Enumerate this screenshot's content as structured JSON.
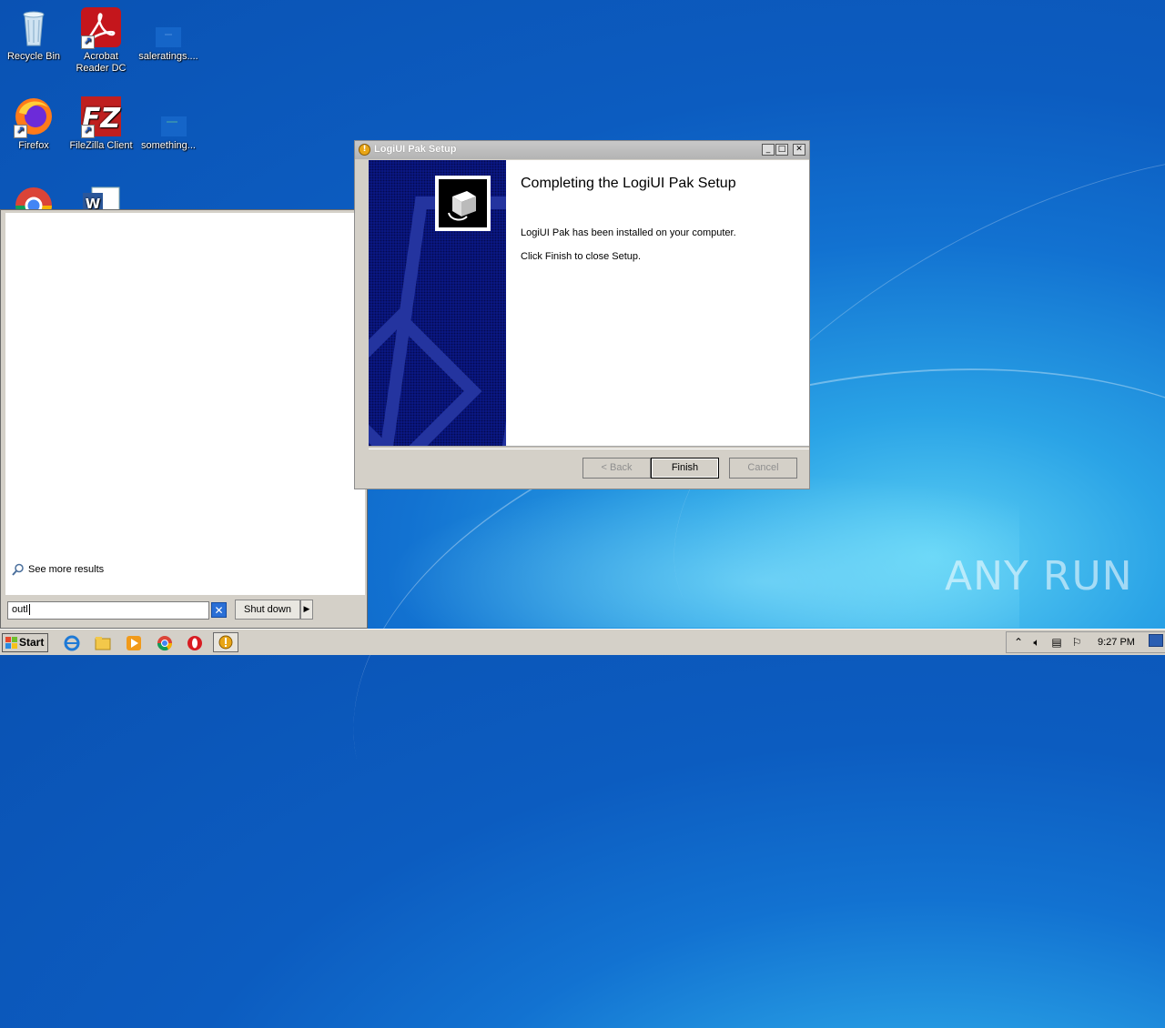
{
  "desktop": {
    "icons": [
      {
        "label": "Recycle Bin"
      },
      {
        "label": "Acrobat Reader DC"
      },
      {
        "label": "saleratings...."
      },
      {
        "label": "Firefox"
      },
      {
        "label": "FileZilla Client"
      },
      {
        "label": "something..."
      }
    ]
  },
  "start_menu": {
    "see_more": "See more results",
    "search_value": "outl",
    "shutdown_label": "Shut down"
  },
  "setup_dialog": {
    "title": "LogiUI Pak Setup",
    "heading": "Completing the LogiUI Pak Setup",
    "line1": "LogiUI Pak has been installed on your computer.",
    "line2": "Click Finish to close Setup.",
    "buttons": {
      "back": "< Back",
      "finish": "Finish",
      "cancel": "Cancel"
    }
  },
  "taskbar": {
    "start_label": "Start",
    "clock": "9:27 PM"
  },
  "watermark": {
    "text": "ANY RUN"
  },
  "colors": {
    "desktop_bg": "#0c5cc0",
    "installer_side": "#0b1a8c",
    "taskbar": "#d4d0c8"
  }
}
